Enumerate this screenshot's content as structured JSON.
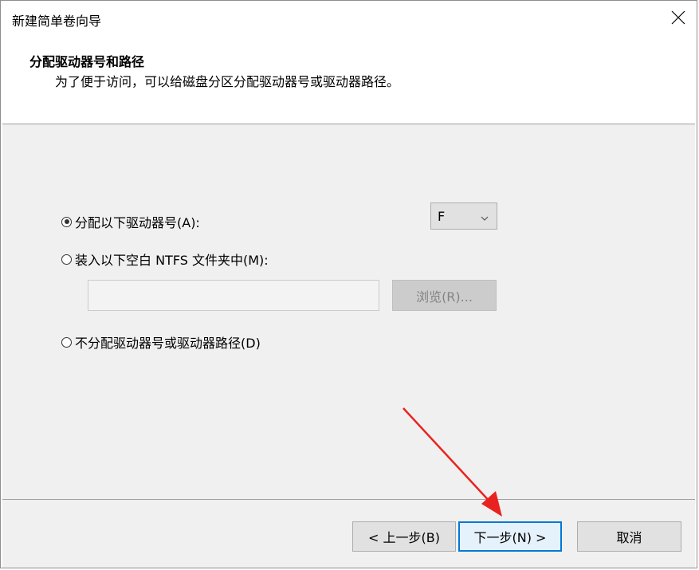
{
  "window": {
    "title": "新建简单卷向导",
    "close_icon": "close-icon"
  },
  "header": {
    "title": "分配驱动器号和路径",
    "subtitle": "为了便于访问，可以给磁盘分区分配驱动器号或驱动器路径。"
  },
  "options": {
    "assign_letter": {
      "label": "分配以下驱动器号(A):",
      "checked": true
    },
    "mount_folder": {
      "label": "装入以下空白 NTFS 文件夹中(M):",
      "checked": false
    },
    "no_assign": {
      "label": "不分配驱动器号或驱动器路径(D)",
      "checked": false
    }
  },
  "drive_letter": {
    "selected": "F",
    "icon": "chevron-down-icon"
  },
  "folder_path": {
    "value": "",
    "placeholder": ""
  },
  "browse_button": {
    "label": "浏览(R)...",
    "enabled": false
  },
  "buttons": {
    "back": "< 上一步(B)",
    "next": "下一步(N) >",
    "cancel": "取消"
  },
  "annotation": {
    "type": "arrow",
    "color": "#e8231f",
    "points_to": "next"
  },
  "colors": {
    "accent": "#0078d7",
    "panel": "#f0f0f0"
  }
}
